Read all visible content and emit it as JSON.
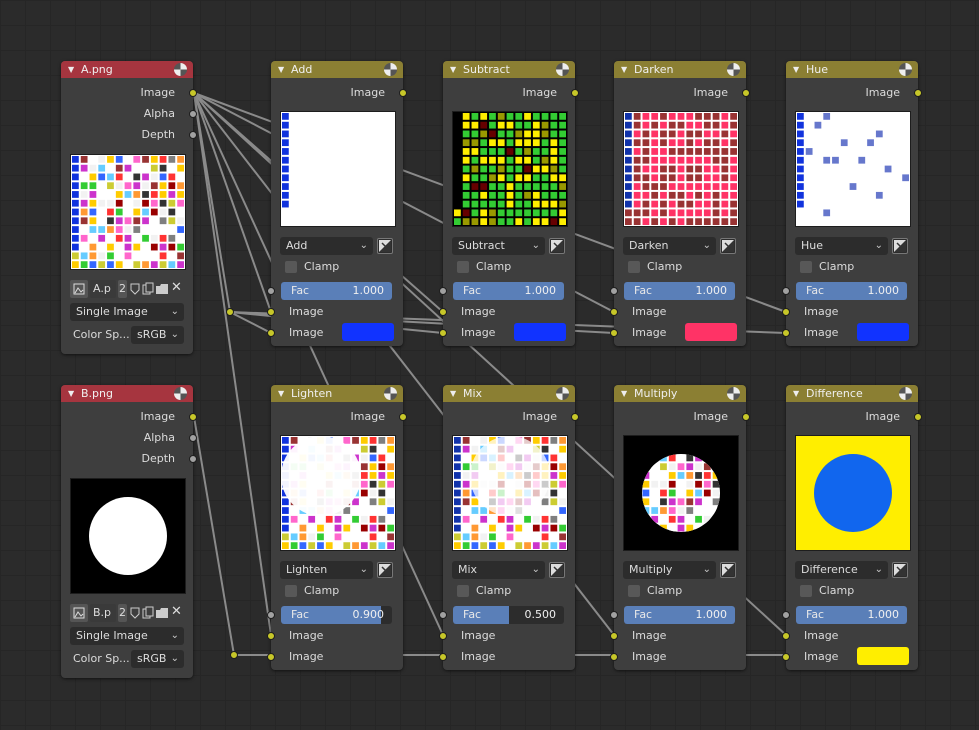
{
  "sockets": {
    "image": "Image",
    "alpha": "Alpha",
    "depth": "Depth",
    "fac": "Fac",
    "clamp": "Clamp"
  },
  "image_nodes": [
    {
      "title": "A.png",
      "file": "A.p",
      "users": "2",
      "source": "Single Image",
      "colorspace_label": "Color Sp...",
      "colorspace": "sRGB"
    },
    {
      "title": "B.png",
      "file": "B.p",
      "users": "2",
      "source": "Single Image",
      "colorspace_label": "Color Sp...",
      "colorspace": "sRGB"
    }
  ],
  "mix_nodes": [
    {
      "title": "Add",
      "mode": "Add",
      "fac": "1.000",
      "fac_fraction": 1.0,
      "color": "#1133ff"
    },
    {
      "title": "Subtract",
      "mode": "Subtract",
      "fac": "1.000",
      "fac_fraction": 1.0,
      "color": "#1133ff"
    },
    {
      "title": "Darken",
      "mode": "Darken",
      "fac": "1.000",
      "fac_fraction": 1.0,
      "color": "#ff3366"
    },
    {
      "title": "Hue",
      "mode": "Hue",
      "fac": "1.000",
      "fac_fraction": 1.0,
      "color": "#1133ff"
    },
    {
      "title": "Lighten",
      "mode": "Lighten",
      "fac": "0.900",
      "fac_fraction": 0.9,
      "color": null
    },
    {
      "title": "Mix",
      "mode": "Mix",
      "fac": "0.500",
      "fac_fraction": 0.5,
      "color": null
    },
    {
      "title": "Multiply",
      "mode": "Multiply",
      "fac": "1.000",
      "fac_fraction": 1.0,
      "color": null
    },
    {
      "title": "Difference",
      "mode": "Difference",
      "fac": "1.000",
      "fac_fraction": 1.0,
      "color": "#ffee00"
    }
  ],
  "colors": {
    "image_header": "#a6353f",
    "mix_header": "#8b7f33",
    "socket_color": "#c7c729",
    "socket_float": "#a1a1a1",
    "fac_fill": "#5a7fb8",
    "link": "#8a8a8a"
  }
}
